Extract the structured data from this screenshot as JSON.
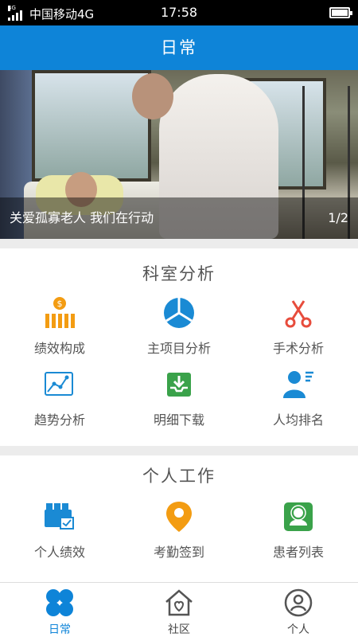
{
  "status": {
    "carrier": "中国移动4G",
    "network": "4G",
    "time": "17:58"
  },
  "header": {
    "title": "日常"
  },
  "banner": {
    "caption": "关爱孤寡老人 我们在行动",
    "pager": "1/2"
  },
  "dept": {
    "title": "科室分析",
    "items": [
      {
        "label": "绩效构成",
        "icon": "performance-bars-icon",
        "color": "#f39c12"
      },
      {
        "label": "主项目分析",
        "icon": "pie-chart-icon",
        "color": "#1a8ad4"
      },
      {
        "label": "手术分析",
        "icon": "scissors-icon",
        "color": "#e74c3c"
      },
      {
        "label": "趋势分析",
        "icon": "trend-chart-icon",
        "color": "#1a8ad4"
      },
      {
        "label": "明细下载",
        "icon": "download-tray-icon",
        "color": "#3aa24a"
      },
      {
        "label": "人均排名",
        "icon": "user-ranking-icon",
        "color": "#1a8ad4"
      }
    ]
  },
  "personal": {
    "title": "个人工作",
    "items": [
      {
        "label": "个人绩效",
        "icon": "personal-performance-icon",
        "color": "#1a8ad4"
      },
      {
        "label": "考勤签到",
        "icon": "location-pin-icon",
        "color": "#f39c12"
      },
      {
        "label": "患者列表",
        "icon": "patient-list-icon",
        "color": "#3aa24a"
      }
    ]
  },
  "tabbar": {
    "items": [
      {
        "label": "日常",
        "icon": "clover-icon",
        "active": true
      },
      {
        "label": "社区",
        "icon": "home-heart-icon",
        "active": false
      },
      {
        "label": "个人",
        "icon": "person-circle-icon",
        "active": false
      }
    ]
  },
  "colors": {
    "primary": "#0e84d8",
    "orange": "#f39c12",
    "green": "#3aa24a",
    "red": "#e74c3c"
  }
}
